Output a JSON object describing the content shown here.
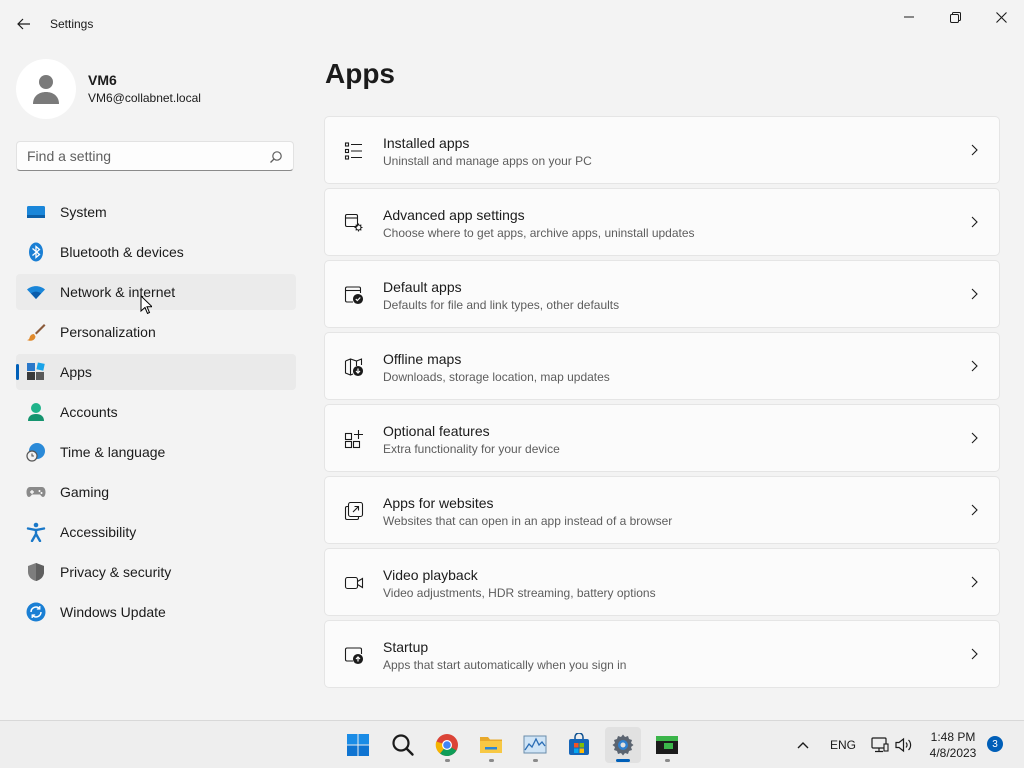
{
  "window": {
    "title": "Settings",
    "controls": [
      "minimize",
      "maximize",
      "close"
    ]
  },
  "profile": {
    "name": "VM6",
    "email": "VM6@collabnet.local"
  },
  "search": {
    "placeholder": "Find a setting",
    "value": ""
  },
  "nav": {
    "items": [
      {
        "label": "System",
        "icon": "monitor-icon"
      },
      {
        "label": "Bluetooth & devices",
        "icon": "bluetooth-icon"
      },
      {
        "label": "Network & internet",
        "icon": "wifi-icon",
        "state": "hover"
      },
      {
        "label": "Personalization",
        "icon": "brush-icon"
      },
      {
        "label": "Apps",
        "icon": "apps-icon",
        "state": "selected"
      },
      {
        "label": "Accounts",
        "icon": "person-icon"
      },
      {
        "label": "Time & language",
        "icon": "globe-clock-icon"
      },
      {
        "label": "Gaming",
        "icon": "gamepad-icon"
      },
      {
        "label": "Accessibility",
        "icon": "accessibility-icon"
      },
      {
        "label": "Privacy & security",
        "icon": "shield-icon"
      },
      {
        "label": "Windows Update",
        "icon": "update-icon"
      }
    ]
  },
  "main": {
    "title": "Apps",
    "cards": [
      {
        "title": "Installed apps",
        "desc": "Uninstall and manage apps on your PC",
        "icon": "list-icon"
      },
      {
        "title": "Advanced app settings",
        "desc": "Choose where to get apps, archive apps, uninstall updates",
        "icon": "app-settings-icon"
      },
      {
        "title": "Default apps",
        "desc": "Defaults for file and link types, other defaults",
        "icon": "default-apps-icon"
      },
      {
        "title": "Offline maps",
        "desc": "Downloads, storage location, map updates",
        "icon": "map-download-icon"
      },
      {
        "title": "Optional features",
        "desc": "Extra functionality for your device",
        "icon": "add-grid-icon"
      },
      {
        "title": "Apps for websites",
        "desc": "Websites that can open in an app instead of a browser",
        "icon": "open-in-app-icon"
      },
      {
        "title": "Video playback",
        "desc": "Video adjustments, HDR streaming, battery options",
        "icon": "video-icon"
      },
      {
        "title": "Startup",
        "desc": "Apps that start automatically when you sign in",
        "icon": "startup-icon"
      }
    ]
  },
  "taskbar": {
    "apps": [
      {
        "name": "start",
        "icon": "windows-start-icon"
      },
      {
        "name": "search",
        "icon": "search-icon"
      },
      {
        "name": "chrome",
        "icon": "chrome-icon"
      },
      {
        "name": "file-explorer",
        "icon": "folder-icon"
      },
      {
        "name": "performance-monitor",
        "icon": "chart-icon"
      },
      {
        "name": "store",
        "icon": "store-icon"
      },
      {
        "name": "settings",
        "icon": "settings-gear-icon",
        "state": "active"
      },
      {
        "name": "terminal",
        "icon": "terminal-icon"
      }
    ],
    "tray": {
      "language": "ENG",
      "time": "1:48 PM",
      "date": "4/8/2023",
      "notification_count": "3"
    }
  },
  "colors": {
    "accent": "#005fb8",
    "background": "#f3f3f3",
    "card": "#fbfbfb"
  }
}
